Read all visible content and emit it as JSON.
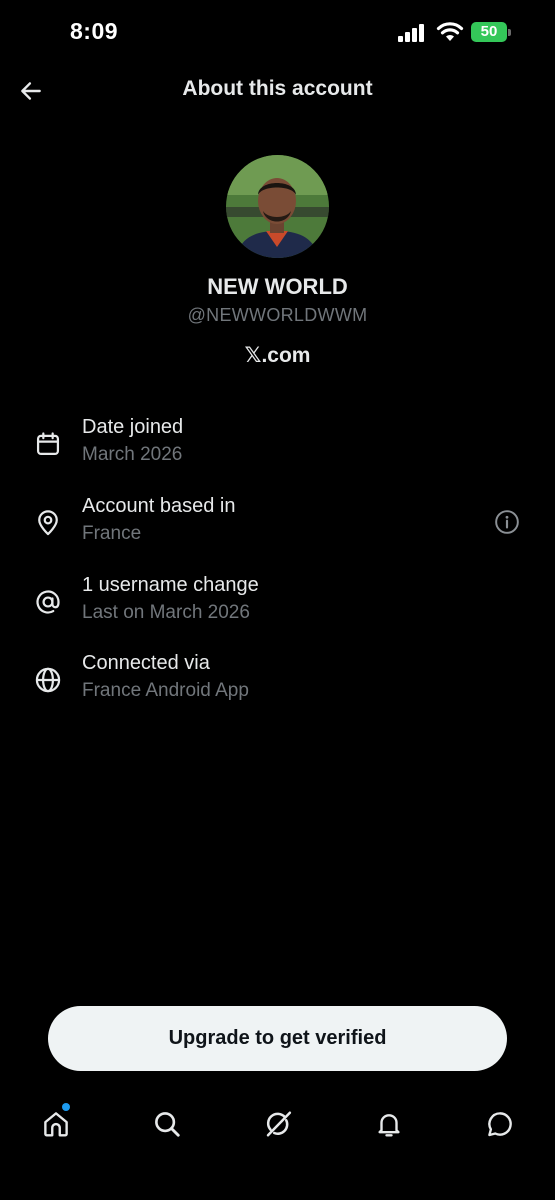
{
  "status_bar": {
    "time": "8:09",
    "battery": "50"
  },
  "header": {
    "title": "About this account",
    "back_icon": "arrow-left-icon"
  },
  "profile": {
    "display_name": "NEW WORLD",
    "handle": "@NEWWORLDWWM",
    "site": "𝕏.com"
  },
  "rows": [
    {
      "icon": "calendar-icon",
      "title": "Date joined",
      "subtitle": "March 2026"
    },
    {
      "icon": "location-pin-icon",
      "title": "Account based in",
      "subtitle": "France",
      "trailing_icon": "info-icon"
    },
    {
      "icon": "at-sign-icon",
      "title": "1 username change",
      "subtitle": "Last on March 2026"
    },
    {
      "icon": "globe-icon",
      "title": "Connected via",
      "subtitle": "France Android App"
    }
  ],
  "cta": {
    "label": "Upgrade to get verified"
  },
  "tab_bar": {
    "items": [
      "home-icon",
      "search-icon",
      "grok-icon",
      "bell-icon",
      "messages-icon"
    ],
    "home_has_badge": true
  },
  "colors": {
    "background": "#000000",
    "primary_text": "#e7e9ea",
    "secondary_text": "#71767b",
    "accent": "#1d9bf0",
    "battery": "#34c759"
  }
}
